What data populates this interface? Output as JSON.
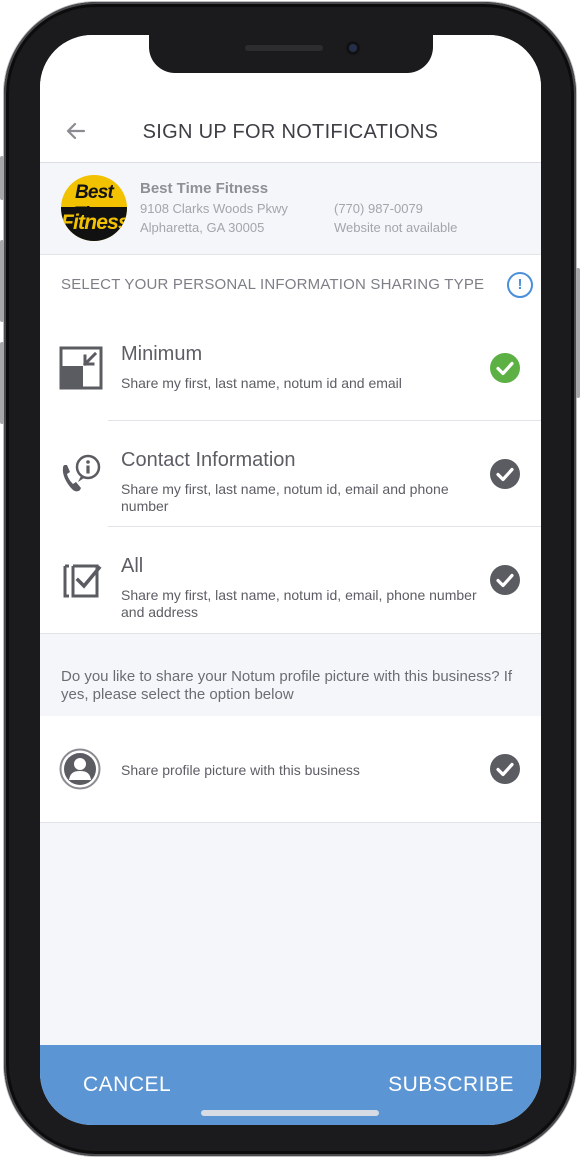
{
  "header": {
    "title": "SIGN UP FOR NOTIFICATIONS"
  },
  "business": {
    "name": "Best Time Fitness",
    "address_line1": "9108 Clarks Woods Pkwy",
    "address_line2": "Alpharetta,  GA 30005",
    "phone": "(770) 987-0079",
    "website": "Website not available",
    "logo": {
      "line1": "Best Time",
      "line2": "Fitness"
    }
  },
  "sharing": {
    "label": "SELECT YOUR PERSONAL INFORMATION SHARING TYPE",
    "options": [
      {
        "title": "Minimum",
        "description": "Share my first, last name, notum id and email",
        "icon": "minimize-icon",
        "selected": true
      },
      {
        "title": "Contact Information",
        "description": "Share my first, last name, notum id, email and phone number",
        "icon": "phone-info-icon",
        "selected": false
      },
      {
        "title": "All",
        "description": "Share my first, last name, notum id, email, phone number and address",
        "icon": "checkbox-icon",
        "selected": false
      }
    ]
  },
  "profile_picture": {
    "question": "Do you like to share your Notum profile picture with this business? If yes, please select the option below",
    "option_label": "Share profile picture with this business",
    "selected": false
  },
  "footer": {
    "cancel_label": "CANCEL",
    "subscribe_label": "SUBSCRIBE"
  },
  "colors": {
    "selected_check": "#5cb044",
    "unselected_check": "#5a5c62",
    "accent": "#5b95d4",
    "info": "#4a90d9"
  }
}
